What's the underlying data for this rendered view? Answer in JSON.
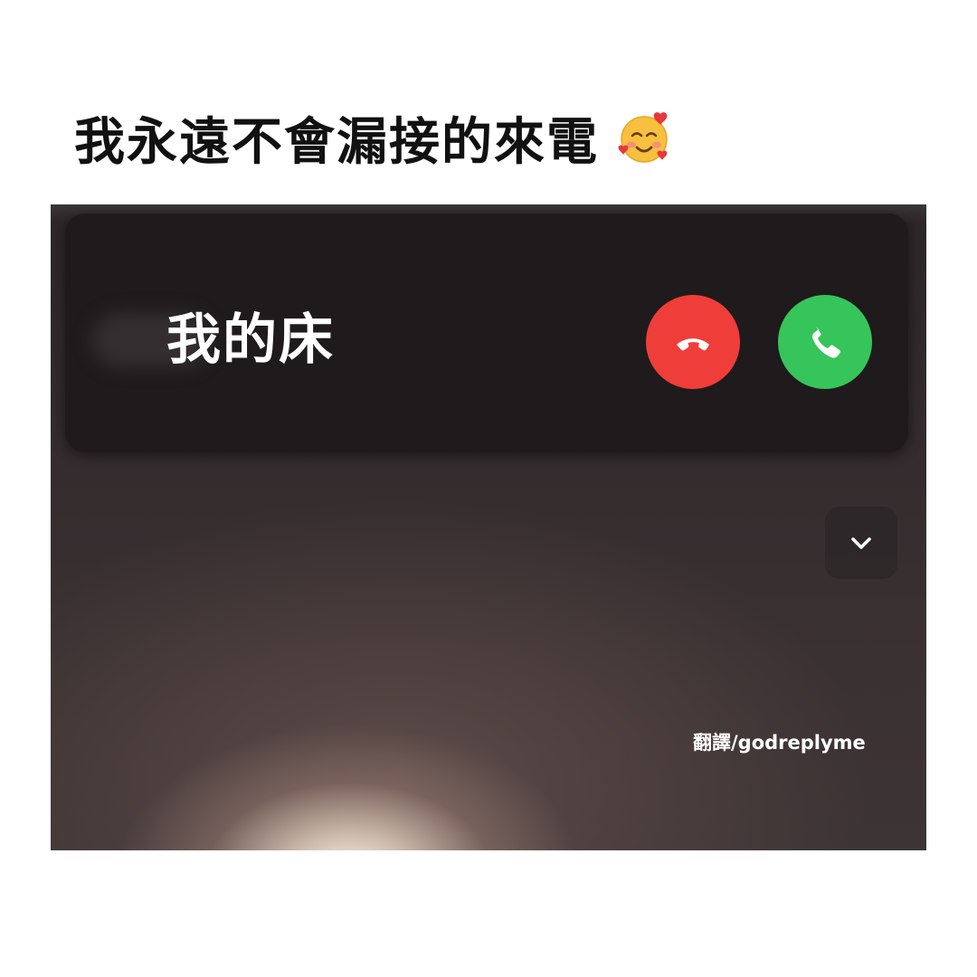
{
  "headline": {
    "text": "我永遠不會漏接的來電",
    "emoji": "smiling-face-with-hearts-icon"
  },
  "call": {
    "caller_name": "我的床",
    "decline": {
      "icon": "phone-hang-up-icon",
      "color": "#ef3d3a"
    },
    "accept": {
      "icon": "phone-icon",
      "color": "#36c55a"
    },
    "collapse_icon": "chevron-down-icon"
  },
  "credit": "翻譯/godreplyme",
  "colors": {
    "banner": "#1f1a1b",
    "decline": "#ef3d3a",
    "accept": "#36c55a",
    "headline": "#111111"
  }
}
